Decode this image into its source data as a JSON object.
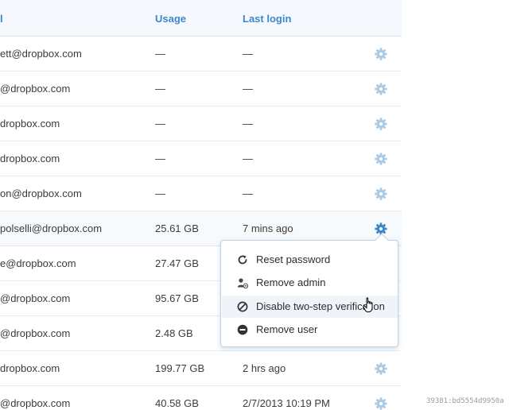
{
  "table": {
    "headers": {
      "email": "l",
      "usage": "Usage",
      "last_login": "Last login"
    },
    "rows": [
      {
        "email": "ett@dropbox.com",
        "usage": "—",
        "last_login": "—"
      },
      {
        "email": "@dropbox.com",
        "usage": "—",
        "last_login": "—"
      },
      {
        "email": "dropbox.com",
        "usage": "—",
        "last_login": "—"
      },
      {
        "email": "dropbox.com",
        "usage": "—",
        "last_login": "—"
      },
      {
        "email": "on@dropbox.com",
        "usage": "—",
        "last_login": "—"
      },
      {
        "email": "polselli@dropbox.com",
        "usage": "25.61 GB",
        "last_login": "7 mins ago"
      },
      {
        "email": "e@dropbox.com",
        "usage": "27.47 GB",
        "last_login": ""
      },
      {
        "email": "@dropbox.com",
        "usage": "95.67 GB",
        "last_login": ""
      },
      {
        "email": "@dropbox.com",
        "usage": "2.48 GB",
        "last_login": ""
      },
      {
        "email": "dropbox.com",
        "usage": "199.77 GB",
        "last_login": "2 hrs ago"
      },
      {
        "email": "@dropbox.com",
        "usage": "40.58 GB",
        "last_login": "2/7/2013 10:19 PM"
      }
    ]
  },
  "action_menu": {
    "items": [
      {
        "label": "Reset password",
        "icon": "refresh-icon"
      },
      {
        "label": "Remove admin",
        "icon": "remove-admin-icon"
      },
      {
        "label": "Disable two-step verification",
        "icon": "no-entry-icon"
      },
      {
        "label": "Remove user",
        "icon": "minus-circle-icon"
      }
    ]
  },
  "footer": {
    "id_text": "39381:bd5554d9950a"
  },
  "colors": {
    "header_text": "#3d88cc",
    "gear_idle": "#a9c9e6",
    "gear_active": "#3a86c8",
    "menu_border": "#bcd3e8"
  }
}
